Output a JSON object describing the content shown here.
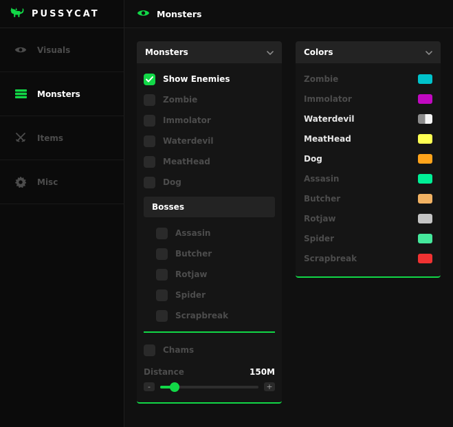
{
  "theme": {
    "accent": "#12d847",
    "panel_bg": "#151515",
    "header_bg": "#232323"
  },
  "app": {
    "brand": "PUSSYCAT",
    "logo_icon": "cat-icon"
  },
  "topbar": {
    "icon": "eye-icon",
    "title": "Monsters"
  },
  "sidebar": {
    "items": [
      {
        "label": "Visuals",
        "icon": "eye-icon",
        "active": false
      },
      {
        "label": "Monsters",
        "icon": "list-icon",
        "active": true
      },
      {
        "label": "Items",
        "icon": "swords-icon",
        "active": false
      },
      {
        "label": "Misc",
        "icon": "gear-icon",
        "active": false
      }
    ]
  },
  "monsters_panel": {
    "header": "Monsters",
    "show_enemies": {
      "label": "Show Enemies",
      "checked": true
    },
    "enemies": [
      "Zombie",
      "Immolator",
      "Waterdevil",
      "MeatHead",
      "Dog"
    ],
    "bosses_header": "Bosses",
    "bosses": [
      "Assasin",
      "Butcher",
      "Rotjaw",
      "Spider",
      "Scrapbreak"
    ],
    "chams": {
      "label": "Chams",
      "checked": false
    },
    "distance": {
      "label": "Distance",
      "value": "150M",
      "percent": 15,
      "minus": "-",
      "plus": "+"
    }
  },
  "colors_panel": {
    "header": "Colors",
    "items": [
      {
        "label": "Zombie",
        "color": "#00c2cb",
        "bright": false
      },
      {
        "label": "Immolator",
        "color": "#c109c1",
        "bright": false
      },
      {
        "label": "Waterdevil",
        "color": "linear-gradient(90deg,#8c8c8c 50%,#f5f5f5 50%)",
        "bright": true
      },
      {
        "label": "MeatHead",
        "color": "#ffff52",
        "bright": true
      },
      {
        "label": "Dog",
        "color": "#ffa41b",
        "bright": true
      },
      {
        "label": "Assasin",
        "color": "#00ef96",
        "bright": false
      },
      {
        "label": "Butcher",
        "color": "#f2b263",
        "bright": false
      },
      {
        "label": "Rotjaw",
        "color": "#c4c4c4",
        "bright": false
      },
      {
        "label": "Spider",
        "color": "#45e89c",
        "bright": false
      },
      {
        "label": "Scrapbreak",
        "color": "#f03232",
        "bright": false
      }
    ]
  }
}
